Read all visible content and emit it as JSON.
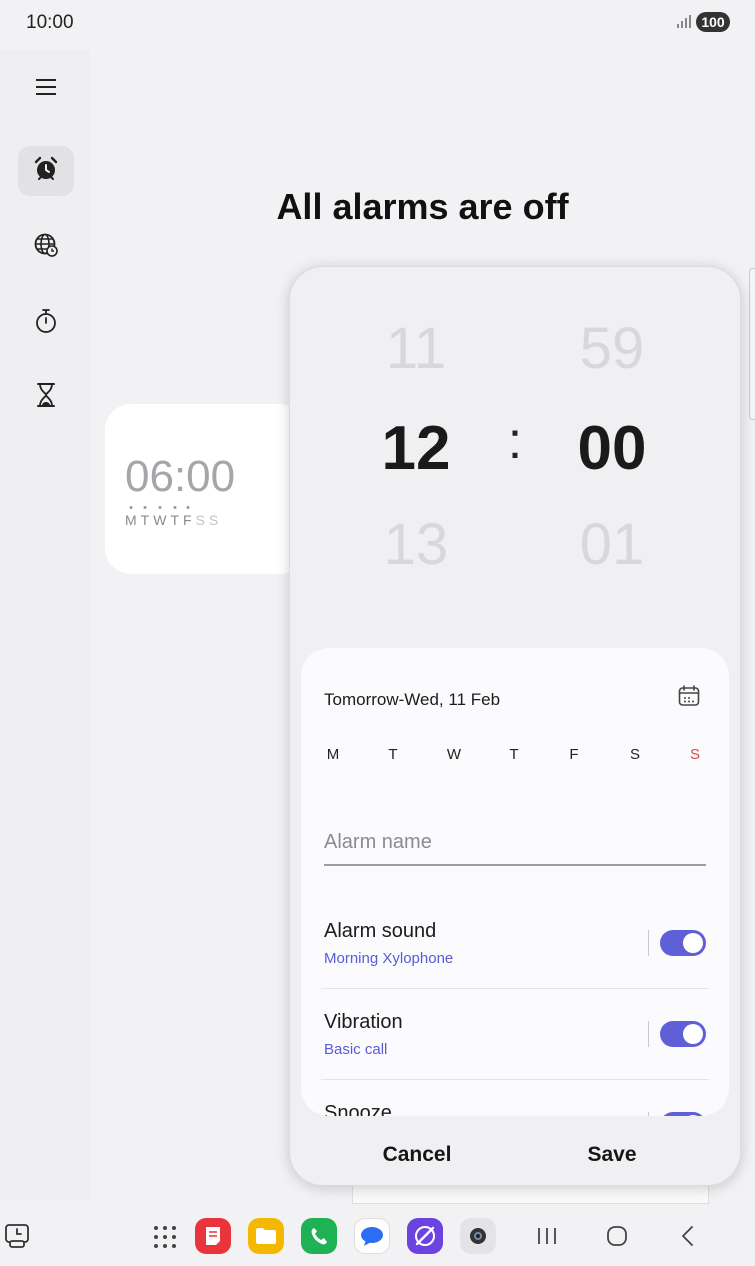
{
  "status_bar": {
    "time": "10:00",
    "battery": "100",
    "signal_icon": "signal-bars-icon"
  },
  "nav_rail": {
    "menu_icon": "hamburger-menu-icon",
    "items": [
      {
        "icon": "alarm-clock-icon",
        "active": true
      },
      {
        "icon": "world-clock-icon",
        "active": false
      },
      {
        "icon": "stopwatch-icon",
        "active": false
      },
      {
        "icon": "timer-hourglass-icon",
        "active": false
      }
    ]
  },
  "main": {
    "headline": "All alarms are off",
    "alarm_card": {
      "time": "06:00",
      "days": [
        "M",
        "T",
        "W",
        "T",
        "F",
        "S",
        "S"
      ]
    }
  },
  "dialog": {
    "picker": {
      "hours": {
        "above": "11",
        "selected": "12",
        "below": "13"
      },
      "separator": ":",
      "minutes": {
        "above": "59",
        "selected": "00",
        "below": "01"
      }
    },
    "date": "Tomorrow-Wed, 11 Feb",
    "calendar_icon": "calendar-icon",
    "weekdays": [
      "M",
      "T",
      "W",
      "T",
      "F",
      "S",
      "S"
    ],
    "alarm_name_placeholder": "Alarm name",
    "settings": [
      {
        "title": "Alarm sound",
        "subtitle": "Morning Xylophone",
        "enabled": true
      },
      {
        "title": "Vibration",
        "subtitle": "Basic call",
        "enabled": true
      },
      {
        "title": "Snooze",
        "subtitle": "",
        "enabled": true
      }
    ],
    "cancel_label": "Cancel",
    "save_label": "Save"
  },
  "colors": {
    "accent": "#5f5fd8",
    "sunday": "#d94b43",
    "background": "#f2f2f4"
  },
  "taskbar": {
    "left_icon": "screen-time-icon",
    "apps": [
      "app-drawer-icon",
      "notes-app-icon",
      "my-files-app-icon",
      "phone-app-icon",
      "messages-app-icon",
      "internet-app-icon",
      "camera-app-icon"
    ],
    "nav": [
      "recents-icon",
      "home-icon",
      "back-icon"
    ]
  }
}
